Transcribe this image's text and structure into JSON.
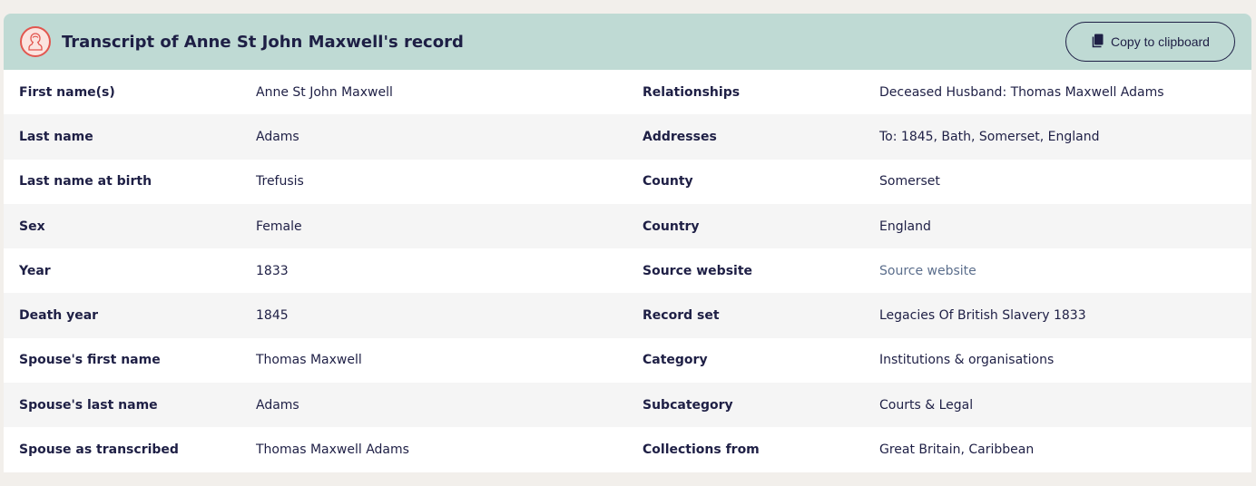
{
  "header": {
    "title": "Transcript of Anne St John Maxwell's record",
    "copy_label": "Copy to clipboard",
    "badge_icon": "person-portrait-icon",
    "copy_icon": "copy-icon"
  },
  "rows": [
    {
      "label_left": "First name(s)",
      "value_left": "Anne St John Maxwell",
      "label_right": "Relationships",
      "value_right": "Deceased Husband: Thomas Maxwell Adams"
    },
    {
      "label_left": "Last name",
      "value_left": "Adams",
      "label_right": "Addresses",
      "value_right": "To: 1845, Bath, Somerset, England"
    },
    {
      "label_left": "Last name at birth",
      "value_left": "Trefusis",
      "label_right": "County",
      "value_right": "Somerset"
    },
    {
      "label_left": "Sex",
      "value_left": "Female",
      "label_right": "Country",
      "value_right": "England"
    },
    {
      "label_left": "Year",
      "value_left": "1833",
      "label_right": "Source website",
      "value_right": "Source website"
    },
    {
      "label_left": "Death year",
      "value_left": "1845",
      "label_right": "Record set",
      "value_right": "Legacies Of British Slavery 1833"
    },
    {
      "label_left": "Spouse's first name",
      "value_left": "Thomas Maxwell",
      "label_right": "Category",
      "value_right": "Institutions & organisations"
    },
    {
      "label_left": "Spouse's last name",
      "value_left": "Adams",
      "label_right": "Subcategory",
      "value_right": "Courts & Legal"
    },
    {
      "label_left": "Spouse as transcribed",
      "value_left": "Thomas Maxwell Adams",
      "label_right": "Collections from",
      "value_right": "Great Britain, Caribbean"
    }
  ],
  "colors": {
    "header_bg": "#bfdad4",
    "text": "#1e1f45",
    "link": "#5b6e8c",
    "badge_accent": "#e2564f"
  }
}
